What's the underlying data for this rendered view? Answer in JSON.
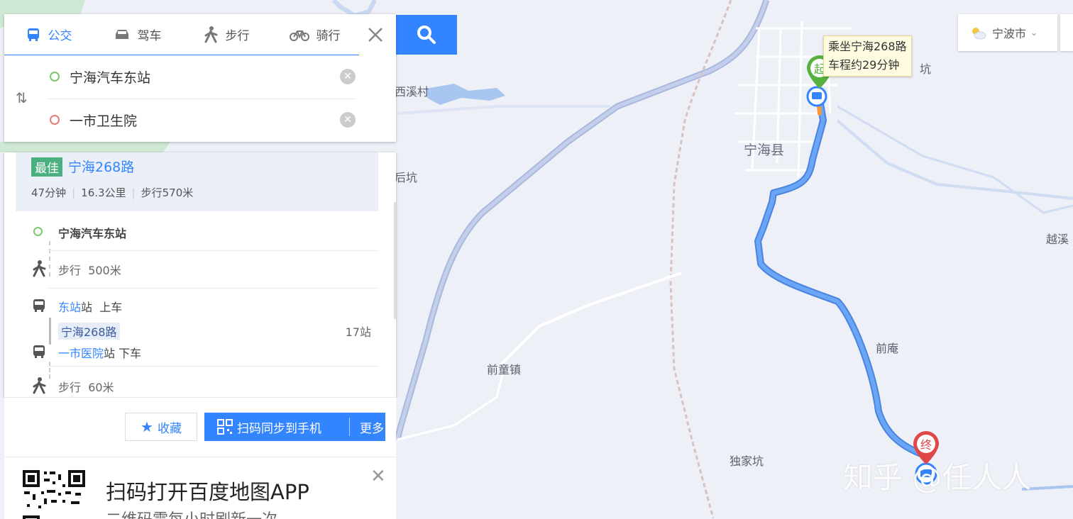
{
  "map": {
    "place_labels": [
      "西溪村",
      "后坑",
      "宁海县",
      "坑",
      "越溪",
      "前庵",
      "前童镇",
      "独家坑"
    ],
    "route_tooltip": {
      "line1": "乘坐宁海268路",
      "line2": "车程约29分钟"
    },
    "start_marker": "起",
    "end_marker": "终",
    "route_color": "#5b9bf0"
  },
  "weather": {
    "city": "宁波市"
  },
  "tabs": [
    {
      "label": "公交",
      "icon": "bus-icon",
      "active": true
    },
    {
      "label": "驾车",
      "icon": "car-icon",
      "active": false
    },
    {
      "label": "步行",
      "icon": "walk-icon",
      "active": false
    },
    {
      "label": "骑行",
      "icon": "bike-icon",
      "active": false
    }
  ],
  "search": {
    "origin": "宁海汽车东站",
    "destination": "一市卫生院"
  },
  "route": {
    "badge": "最佳",
    "name": "宁海268路",
    "duration": "47分钟",
    "distance": "16.3公里",
    "walk_prefix": "步行",
    "walk_value": "570米"
  },
  "steps": {
    "start": "宁海汽车东站",
    "walk1_label": "步行",
    "walk1_value": "500米",
    "board_stop": "东站",
    "board_suffix": "站",
    "board_action": "上车",
    "bus_line": "宁海268路",
    "bus_stops": "17站",
    "alight_stop": "一市医院",
    "alight_suffix": "站",
    "alight_action": "下车",
    "walk2_label": "步行",
    "walk2_value": "60米"
  },
  "actions": {
    "favorite": "收藏",
    "sync": "扫码同步到手机",
    "more": "更多"
  },
  "qr": {
    "title": "扫码打开百度地图APP",
    "subtitle": "二维码需每小时刷新一次"
  },
  "watermark": "知乎 @任人人",
  "colors": {
    "accent": "#3385ff",
    "best_badge": "#4caf80",
    "start": "#7cc86a",
    "end": "#e05a5a"
  }
}
